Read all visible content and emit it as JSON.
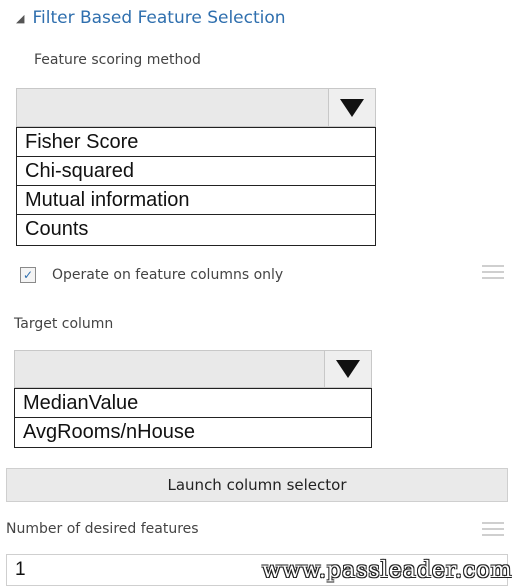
{
  "section": {
    "title": "Filter Based Feature Selection",
    "collapse_icon": "collapse-triangle-icon"
  },
  "scoring": {
    "label": "Feature scoring method",
    "selected": "",
    "options": [
      "Fisher Score",
      "Chi-squared",
      "Mutual information",
      "Counts"
    ]
  },
  "operate": {
    "label": "Operate on feature columns only",
    "checked": true,
    "check_glyph": "✓"
  },
  "target": {
    "label": "Target column",
    "selected": "",
    "options": [
      "MedianValue",
      "AvgRooms/nHouse"
    ]
  },
  "launch": {
    "label": "Launch column selector"
  },
  "features": {
    "label": "Number of desired features",
    "value": "1"
  },
  "watermark": "www.passleader.com",
  "colors": {
    "accent": "#2f6fae"
  }
}
